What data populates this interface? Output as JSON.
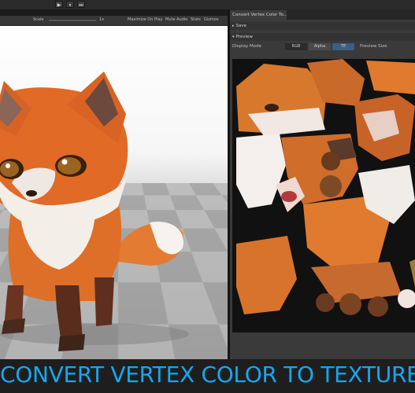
{
  "toolbar": {
    "play_icon": "▶",
    "pause_icon": "⏸",
    "step_icon": "⏭"
  },
  "game_view": {
    "scale_label": "Scale",
    "scale_value": "1x",
    "maximize": "Maximize On Play",
    "mute": "Mute Audio",
    "stats": "Stats",
    "gizmos": "Gizmos"
  },
  "inspector": {
    "tab_title": "Convert Vertex Color To...",
    "save_label": "Save",
    "preview_label": "Preview",
    "display_mode_label": "Display Mode",
    "modes": [
      "RGB",
      "Alpha",
      "TE"
    ],
    "preview_size_label": "Preview Size"
  },
  "caption": "CONVERT VERTEX COLOR TO TEXTURE",
  "colors": {
    "caption": "#17a7ef",
    "fox_orange": "#e0702a",
    "fox_white": "#f4eee9",
    "fox_dark": "#4a2a1e"
  }
}
